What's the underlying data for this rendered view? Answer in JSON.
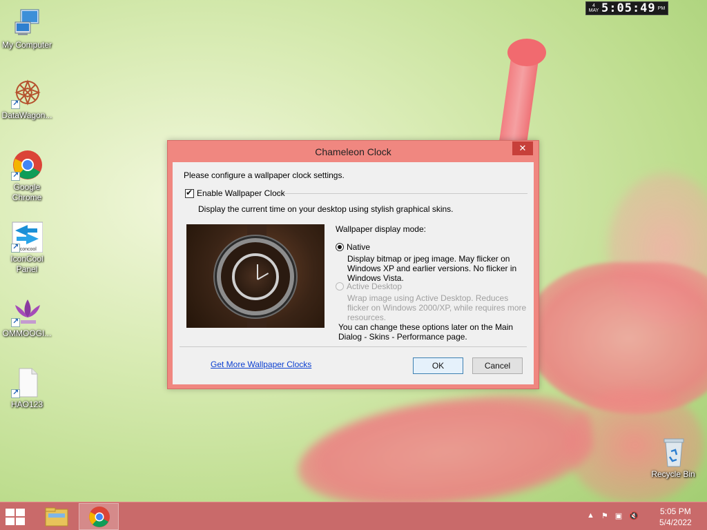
{
  "desktop": {
    "icons": [
      {
        "label": "My Computer"
      },
      {
        "label": "DataWagon..."
      },
      {
        "label": "Google Chrome"
      },
      {
        "label": "IconCool Panel"
      },
      {
        "label": "OMMOOGI..."
      },
      {
        "label": "HAO123"
      },
      {
        "label": "Recycle Bin"
      }
    ],
    "iconcool_badge": "iconcool"
  },
  "clock_widget": {
    "day": "4",
    "month": "MAY",
    "time": "5:05:49",
    "ampm": "PM"
  },
  "dialog": {
    "title": "Chameleon Clock",
    "close_glyph": "✕",
    "intro": "Please configure a wallpaper clock settings.",
    "enable_label": "Enable Wallpaper Clock",
    "enable_checked": true,
    "enable_desc": "Display the current time on your desktop using stylish graphical skins.",
    "mode_label": "Wallpaper display mode:",
    "options": [
      {
        "label": "Native",
        "desc": "Display bitmap or jpeg image. May flicker on Windows XP and earlier versions. No flicker in Windows Vista.",
        "selected": true,
        "enabled": true
      },
      {
        "label": "Active Desktop",
        "desc": "Wrap image using Active Desktop. Reduces flicker on Windows 2000/XP, while requires more resources.",
        "selected": false,
        "enabled": false
      }
    ],
    "note": "You can change these options later on the Main Dialog - Skins - Performance page.",
    "link": "Get More Wallpaper Clocks",
    "ok_label": "OK",
    "cancel_label": "Cancel"
  },
  "taskbar": {
    "time": "5:05 PM",
    "date": "5/4/2022"
  },
  "colors": {
    "dialog_frame": "#f08780",
    "taskbar": "#c96a6a",
    "link": "#0b3fd0"
  }
}
